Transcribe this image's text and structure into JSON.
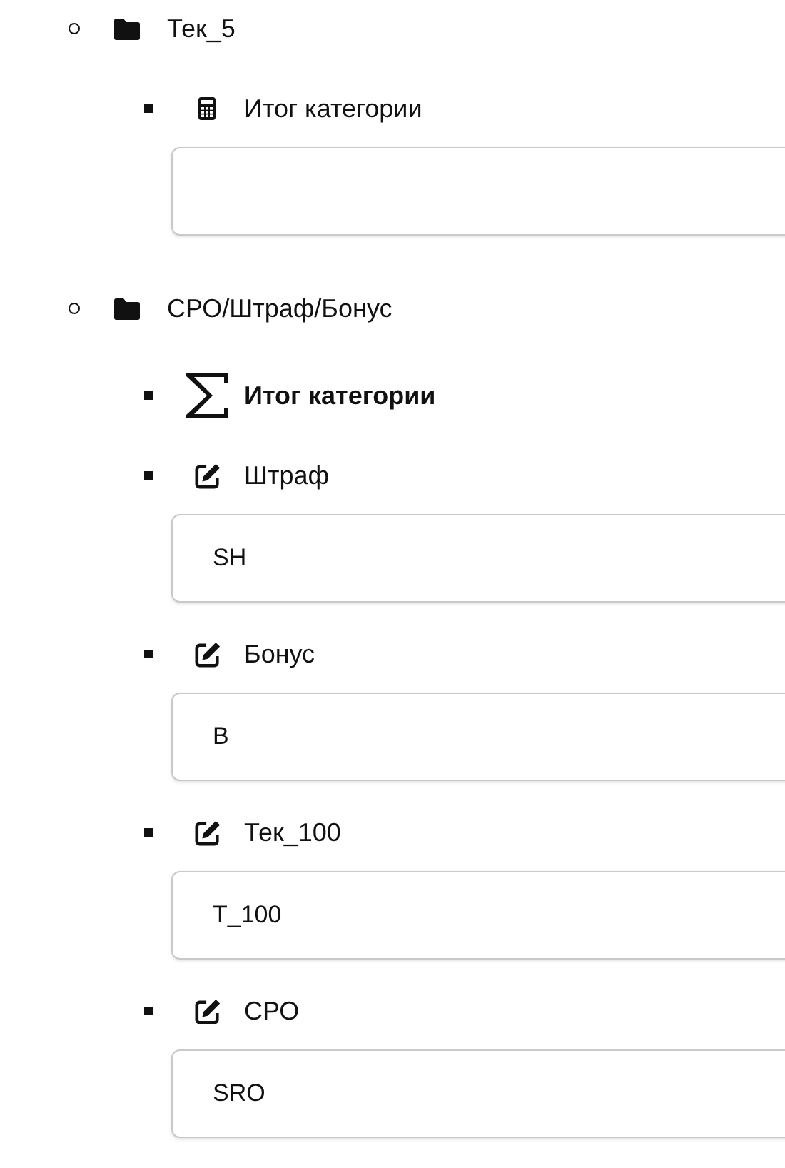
{
  "groups": [
    {
      "title": "Тек_5",
      "items": [
        {
          "kind": "calc",
          "label": "Итог категории"
        }
      ]
    },
    {
      "title": "СРО/Штраф/Бонус",
      "items": [
        {
          "kind": "sum",
          "label": "Итог категории"
        },
        {
          "kind": "edit",
          "label": "Штраф",
          "value": "SH"
        },
        {
          "kind": "edit",
          "label": "Бонус",
          "value": "B"
        },
        {
          "kind": "edit",
          "label": "Тек_100",
          "value": "T_100"
        },
        {
          "kind": "edit",
          "label": "СРО",
          "value": "SRO"
        }
      ]
    }
  ]
}
